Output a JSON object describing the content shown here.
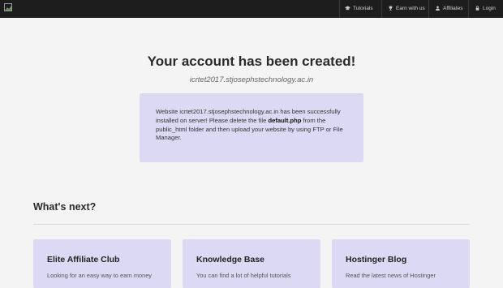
{
  "nav": {
    "items": [
      {
        "label": "Tutorials",
        "icon": "graduation-cap-icon"
      },
      {
        "label": "Earn with us",
        "icon": "trophy-icon"
      },
      {
        "label": "Affiliates",
        "icon": "user-icon"
      },
      {
        "label": "Login",
        "icon": "lock-icon"
      }
    ]
  },
  "main": {
    "title": "Your account has been created!",
    "domain": "icrtet2017.stjosephstechnology.ac.in",
    "notice": {
      "text_before": "Website icrtet2017.stjosephstechnology.ac.in has been successfully installed on server! Please delete the file ",
      "filename": "default.php",
      "text_after": " from the public_html folder and then upload your website by using FTP or File Manager."
    }
  },
  "next": {
    "heading": "What's next?",
    "cards": [
      {
        "title": "Elite Affiliate Club",
        "text": "Looking for an easy way to earn money"
      },
      {
        "title": "Knowledge Base",
        "text": "You can find a lot of helpful tutorials"
      },
      {
        "title": "Hostinger Blog",
        "text": "Read the latest news of Hostinger"
      }
    ]
  },
  "colors": {
    "topbar": "#1d1d1d",
    "card_bg": "#dcd9f4",
    "page_bg": "#f4f4f4"
  }
}
